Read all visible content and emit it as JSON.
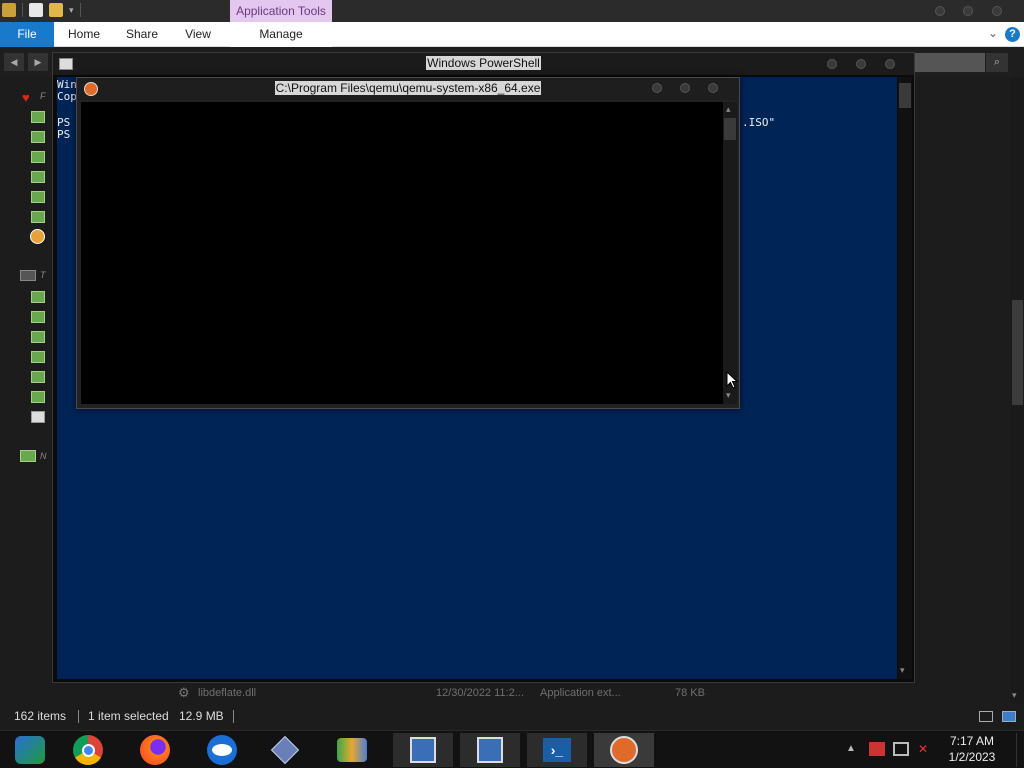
{
  "explorer": {
    "context_tab": "Application Tools",
    "ribbon_tabs": {
      "file": "File",
      "home": "Home",
      "share": "Share",
      "view": "View",
      "manage": "Manage"
    },
    "help_glyph": "?",
    "file_row": {
      "name": "libdeflate.dll",
      "date": "12/30/2022 11:2...",
      "type": "Application ext...",
      "size": "78 KB"
    },
    "status": {
      "items": "162 items",
      "selected": "1 item selected",
      "size": "12.9 MB"
    }
  },
  "powershell": {
    "title": "Windows PowerShell",
    "lines": [
      "Win",
      "Cop",
      "",
      "PS",
      "PS"
    ],
    "partial_tail": ".ISO\""
  },
  "qemu": {
    "title": "C:\\Program Files\\qemu\\qemu-system-x86_64.exe"
  },
  "taskbar": {
    "apps": [
      "windows-media-icon",
      "chrome-icon",
      "firefox-icon",
      "opera-icon",
      "app-diamond-icon",
      "network-people-icon",
      "remote-desktop-icon",
      "remote-desktop-2-icon",
      "powershell-icon",
      "qemu-icon"
    ],
    "clock": {
      "time": "7:17 AM",
      "date": "1/2/2023"
    }
  }
}
